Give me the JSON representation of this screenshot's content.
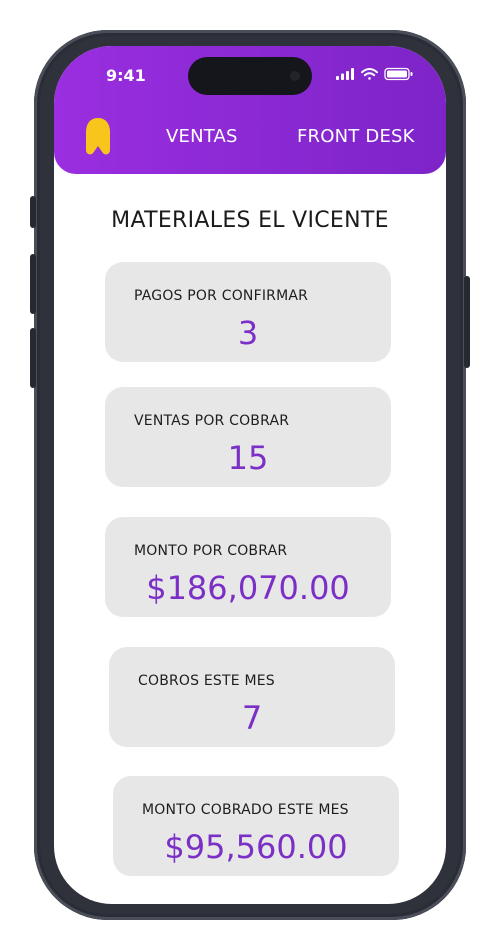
{
  "status_bar": {
    "time": "9:41"
  },
  "nav": {
    "ventas": "VENTAS",
    "front_desk": "FRONT DESK"
  },
  "company_title": "MATERIALES EL VICENTE",
  "cards": [
    {
      "label": "PAGOS POR CONFIRMAR",
      "value": "3"
    },
    {
      "label": "VENTAS POR COBRAR",
      "value": "15"
    },
    {
      "label": "MONTO POR COBRAR",
      "value": "$186,070.00"
    },
    {
      "label": "COBROS ESTE MES",
      "value": "7"
    },
    {
      "label": "MONTO COBRADO ESTE MES",
      "value": "$95,560.00"
    }
  ],
  "colors": {
    "header": "#8a29d6",
    "value_text": "#7b2fc6",
    "card_bg": "#e7e7e7",
    "logo": "#f8c51c"
  },
  "icons": [
    "app-logo-icon",
    "cellular-signal-icon",
    "wifi-icon",
    "battery-icon"
  ]
}
